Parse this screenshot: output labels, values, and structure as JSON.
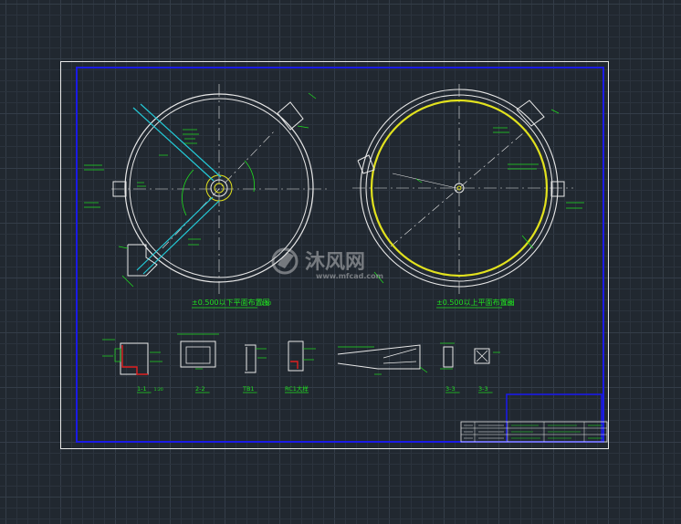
{
  "drawing": {
    "plan_left_title": "±0.500以下平面布置图",
    "plan_left_scale": "1:50",
    "plan_right_title": "±0.500以上平面布置图",
    "plan_right_scale": "1:50",
    "sections": [
      {
        "label": "1-1",
        "scale": "1:20"
      },
      {
        "label": "2-2",
        "scale": ""
      },
      {
        "label": "TB1",
        "scale": ""
      },
      {
        "label": "RC1大样",
        "scale": ""
      },
      {
        "label": "",
        "scale": ""
      },
      {
        "label": "3-3",
        "scale": ""
      },
      {
        "label": "3-3",
        "scale": ""
      }
    ]
  },
  "watermark": {
    "brand": "沐风网",
    "url": "www.mfcad.com"
  },
  "colors": {
    "background": "#212830",
    "frame_outer": "#e8e8e8",
    "frame_inner": "#1a1ae6",
    "geometry": "#e8e8e8",
    "annotation": "#1fe01f",
    "pipe": "#23c9d6",
    "ring": "#e2e21e",
    "rebar": "#e02020"
  }
}
